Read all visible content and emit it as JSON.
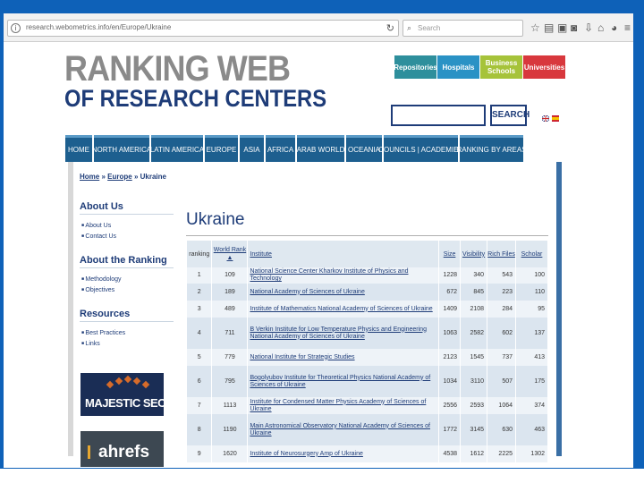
{
  "browser": {
    "url": "research.webometrics.info/en/Europe/Ukraine",
    "search_placeholder": "Search"
  },
  "logo": {
    "line1": "RANKING WEB",
    "line2": "OF RESEARCH CENTERS"
  },
  "top_buttons": [
    {
      "label": "Repositories",
      "color": "#2e8f9c"
    },
    {
      "label": "Hospitals",
      "color": "#2a92c5"
    },
    {
      "label": "Business Schools",
      "color": "#a6c33a"
    },
    {
      "label": "Universities",
      "color": "#d8383d"
    }
  ],
  "search": {
    "button": "SEARCH"
  },
  "nav": [
    "HOME",
    "NORTH AMERICA",
    "LATIN AMERICA",
    "EUROPE",
    "ASIA",
    "AFRICA",
    "ARAB WORLD",
    "OCEANIA",
    "COUNCILS | ACADEMIES",
    "RANKING BY AREAS"
  ],
  "breadcrumb": {
    "home": "Home",
    "sep": "»",
    "europe": "Europe",
    "current": "Ukraine"
  },
  "sidebar": {
    "about_us": {
      "heading": "About Us",
      "links": [
        "About Us",
        "Contact Us"
      ]
    },
    "about_ranking": {
      "heading": "About the Ranking",
      "links": [
        "Methodology",
        "Objectives"
      ]
    },
    "resources": {
      "heading": "Resources",
      "links": [
        "Best Practices",
        "Links"
      ]
    },
    "sponsor1": "MAJESTIC SEO",
    "sponsor2": "ahrefs"
  },
  "main": {
    "title": "Ukraine",
    "columns": [
      "ranking",
      "World Rank",
      "Institute",
      "Size",
      "Visibility",
      "Rich Files",
      "Scholar"
    ],
    "rows": [
      {
        "ranking": "1",
        "world": "109",
        "institute": "National Science Center Kharkov Institute of Physics and Technology",
        "size": "1228",
        "visibility": "340",
        "rich": "543",
        "scholar": "100"
      },
      {
        "ranking": "2",
        "world": "189",
        "institute": "National Academy of Sciences of Ukraine",
        "size": "672",
        "visibility": "845",
        "rich": "223",
        "scholar": "110"
      },
      {
        "ranking": "3",
        "world": "489",
        "institute": "Institute of Mathematics National Academy of Sciences of Ukraine",
        "size": "1409",
        "visibility": "2108",
        "rich": "284",
        "scholar": "95"
      },
      {
        "ranking": "4",
        "world": "711",
        "institute": "B Verkin Institute for Low Temperature Physics and Engineering National Academy of Sciences of Ukraine",
        "size": "1063",
        "visibility": "2582",
        "rich": "602",
        "scholar": "137"
      },
      {
        "ranking": "5",
        "world": "779",
        "institute": "National Institute for Strategic Studies",
        "size": "2123",
        "visibility": "1545",
        "rich": "737",
        "scholar": "413"
      },
      {
        "ranking": "6",
        "world": "795",
        "institute": "Bogolyubov Institute for Theoretical Physics National Academy of Sciences of Ukraine",
        "size": "1034",
        "visibility": "3110",
        "rich": "507",
        "scholar": "175"
      },
      {
        "ranking": "7",
        "world": "1113",
        "institute": "Institute for Condensed Matter Physics Academy of Sciences of Ukraine",
        "size": "2556",
        "visibility": "2593",
        "rich": "1064",
        "scholar": "374"
      },
      {
        "ranking": "8",
        "world": "1190",
        "institute": "Main Astronomical Observatory National Academy of Sciences of Ukraine",
        "size": "1772",
        "visibility": "3145",
        "rich": "630",
        "scholar": "463"
      },
      {
        "ranking": "9",
        "world": "1620",
        "institute": "Institute of Neurosurgery Amp of Ukraine",
        "size": "4538",
        "visibility": "1612",
        "rich": "2225",
        "scholar": "1302"
      }
    ]
  }
}
